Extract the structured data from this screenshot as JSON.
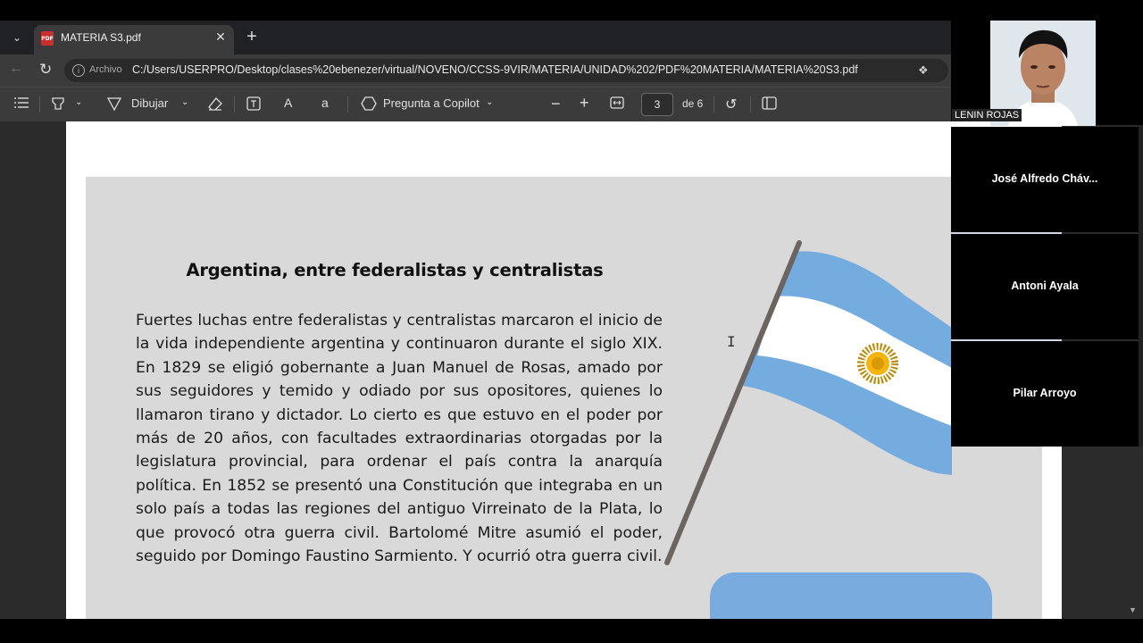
{
  "browser": {
    "tab_title": "MATERIA S3.pdf",
    "pdf_badge": "PDF",
    "url_label": "Archivo",
    "url": "C:/Users/USERPRO/Desktop/clases%20ebenezer/virtual/NOVENO/CCSS-9VIR/MATERIA/UNIDAD%202/PDF%20MATERIA/MATERIA%20S3.pdf"
  },
  "toolbar": {
    "draw_label": "Dibujar",
    "copilot_label": "Pregunta a Copilot",
    "current_page": "3",
    "page_total": "de 6",
    "read_aloud_glyph": "A",
    "translate_glyph": "a"
  },
  "document": {
    "title": "Argentina, entre federalistas y centralistas",
    "body": "Fuertes luchas entre federalistas y centralistas marcaron el inicio de la vida independiente argentina y continuaron durante el siglo XIX. En 1829 se eligió gobernante a Juan Manuel de Rosas, amado por sus seguidores y temido y odiado por sus opositores, quienes lo llamaron tirano y dictador. Lo cierto es que estuvo en el poder por más de 20 años, con facultades extraordinarias otorgadas por la legislatura provincial, para ordenar el país contra la anarquía política. En 1852 se presentó una Constitución que integraba en un solo país a todas las regiones del antiguo Virreinato de la Plata, lo que provocó otra guerra civil. Bartolomé Mitre asumió el poder, seguido por Domingo Faustino Sarmiento. Y ocurrió otra guerra civil."
  },
  "meeting": {
    "presenter": "LENIN ROJAS",
    "participants": [
      {
        "name": "José Alfredo Cháv..."
      },
      {
        "name": "Antoni Ayala"
      },
      {
        "name": "Pilar Arroyo"
      }
    ]
  },
  "colors": {
    "flag_blue": "#74acdf",
    "sun": "#f6b40e",
    "pole": "#6b6461",
    "slide_bg": "#d9d9d9"
  },
  "icons": [
    "tab-list-icon",
    "close-icon",
    "plus-icon",
    "back-icon",
    "reload-icon",
    "info-icon",
    "contents-icon",
    "highlight-icon",
    "draw-icon",
    "eraser-icon",
    "text-box-icon",
    "read-aloud-icon",
    "translate-icon",
    "copilot-icon",
    "zoom-out-icon",
    "zoom-in-icon",
    "fit-width-icon",
    "rotate-icon",
    "page-view-icon"
  ]
}
